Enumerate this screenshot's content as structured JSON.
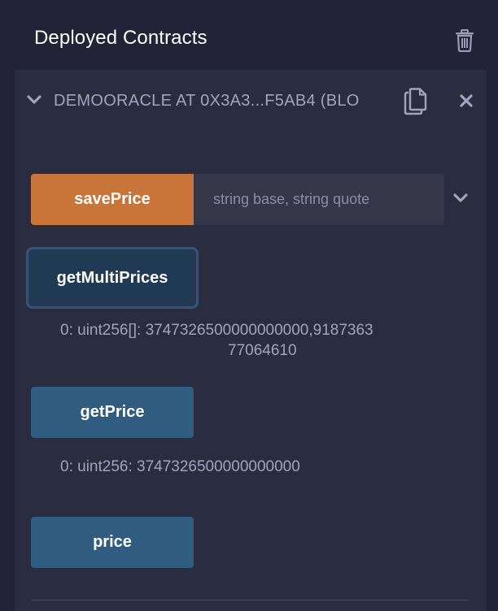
{
  "header": {
    "title": "Deployed Contracts",
    "trash_icon": "trash-icon"
  },
  "contract": {
    "name": "DEMOORACLE AT 0X3A3...F5AB4 (BLO",
    "icons": [
      "chevron-down-icon",
      "copy-icon",
      "close-icon"
    ]
  },
  "functions": {
    "save_price": {
      "label": "savePrice",
      "placeholder": "string base, string quote",
      "value": ""
    },
    "get_multi_prices": {
      "label": "getMultiPrices",
      "output_line1": "0:  uint256[]: 3747326500000000000,9187363",
      "output_line2": "77064610"
    },
    "get_price": {
      "label": "getPrice",
      "output": "0: uint256: 3747326500000000000"
    },
    "price": {
      "label": "price"
    }
  },
  "colors": {
    "background": "#222336",
    "panel": "#2a2c3f",
    "transact_button": "#c97539",
    "call_button": "#2f5c7f",
    "focused_button": "#1f3a52",
    "muted_text": "#a2a3bd"
  }
}
